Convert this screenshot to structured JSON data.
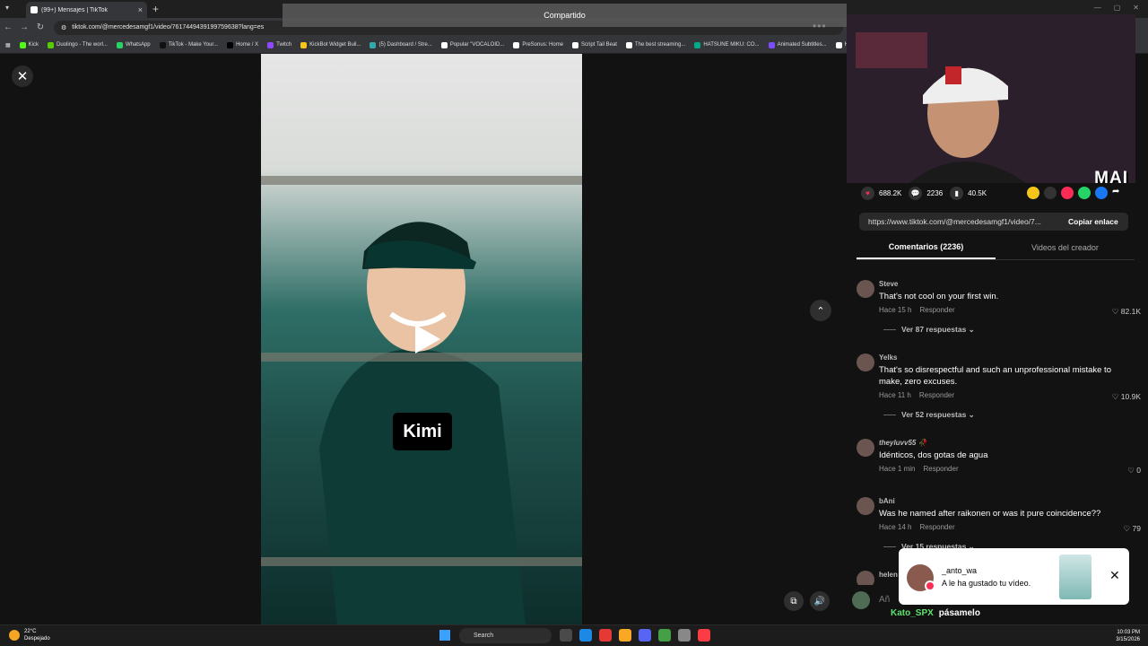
{
  "browser": {
    "tab_title": "(99+) Mensajes | TikTok",
    "url": "tiktok.com/@mercedesamgf1/video/7617449439199759638?lang=es",
    "bookmarks": [
      "Kick",
      "Duolingo - The worl...",
      "WhatsApp",
      "TikTok - Make Your...",
      "Home / X",
      "Twitch",
      "KickBot Widget Buil...",
      "(5) Dashboard / Stre...",
      "Popular \"VOCALOID...",
      "PreSonus: Home",
      "Script Tail Beat",
      "The best streaming...",
      "HATSUNE MIKU: CO...",
      "Animated Subtitles...",
      "HA"
    ],
    "colors": {
      "chrome_bg": "#35363a",
      "tab_bg": "#1f1f1f"
    }
  },
  "video": {
    "caption_overlay": "Compartido",
    "text_sticker": "Kimi",
    "play_icon": "play-icon",
    "more_icon": "more-dots-icon"
  },
  "webcam": {
    "overlay_text": "MAI"
  },
  "stats": {
    "likes": "688.2K",
    "comments": "2236",
    "saves": "40.5K"
  },
  "share": {
    "url": "https://www.tiktok.com/@mercedesamgf1/video/7...",
    "copy_label": "Copiar enlace"
  },
  "tabs": {
    "comments": "Comentarios (2236)",
    "creator": "Videos del creador"
  },
  "comments": [
    {
      "user": "Steve",
      "text": "That's not cool on your first win.",
      "time": "Hace 15 h",
      "reply": "Responder",
      "likes": "82.1K",
      "replies": "Ver 87 respuestas"
    },
    {
      "user": "Yelks",
      "text": "That's so disrespectful and such an unprofessional mistake to make, zero excuses.",
      "time": "Hace 11 h",
      "reply": "Responder",
      "likes": "10.9K",
      "replies": "Ver 52 respuestas"
    },
    {
      "user": "theyluvv55 🥀",
      "text": "Idénticos, dos gotas de agua",
      "time": "Hace 1 min",
      "reply": "Responder",
      "likes": "0",
      "replies": ""
    },
    {
      "user": "bAni",
      "text": "Was he named after raikonen or was it pure coincidence??",
      "time": "Hace 14 h",
      "reply": "Responder",
      "likes": "79",
      "replies": "Ver 15 respuestas"
    },
    {
      "user": "helen",
      "text": "",
      "time": "",
      "reply": "",
      "likes": "",
      "replies": ""
    }
  ],
  "comment_input": {
    "placeholder": "Añ"
  },
  "chat": {
    "name": "Kato_SPX",
    "message": "pásamelo"
  },
  "notification": {
    "user": "_anto_wa",
    "message": "A le ha gustado tu vídeo."
  },
  "taskbar": {
    "temp": "22°C",
    "weather": "Despejado",
    "search": "Search",
    "time": "10:03 PM",
    "date": "3/15/2026"
  },
  "accent": {
    "like_red": "#fe2c55",
    "chat_green": "#5fe36d"
  }
}
